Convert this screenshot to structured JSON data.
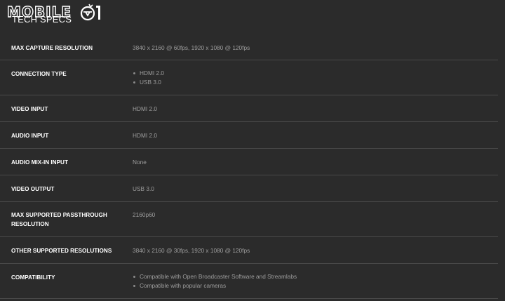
{
  "brand": {
    "logo_text": "MOBILE",
    "logo_mark": "01"
  },
  "section": {
    "title": "TECH SPECS"
  },
  "specs": [
    {
      "label": "MAX CAPTURE RESOLUTION",
      "value": "3840 x 2160 @ 60fps, 1920 x 1080 @ 120fps"
    },
    {
      "label": "CONNECTION TYPE",
      "items": [
        "HDMI 2.0",
        "USB 3.0"
      ]
    },
    {
      "label": "VIDEO INPUT",
      "value": "HDMI 2.0"
    },
    {
      "label": "AUDIO INPUT",
      "value": "HDMI 2.0"
    },
    {
      "label": "AUDIO MIX-IN INPUT",
      "value": "None"
    },
    {
      "label": "VIDEO OUTPUT",
      "value": "USB 3.0"
    },
    {
      "label": "MAX SUPPORTED PASSTHROUGH RESOLUTION",
      "value": "2160p60"
    },
    {
      "label": "OTHER SUPPORTED RESOLUTIONS",
      "value": "3840 x 2160 @ 30fps, 1920 x 1080 @ 120fps"
    },
    {
      "label": "COMPATIBILITY",
      "items": [
        "Compatible with Open Broadcaster Software and Streamlabs",
        "Compatible with popular cameras"
      ]
    }
  ]
}
